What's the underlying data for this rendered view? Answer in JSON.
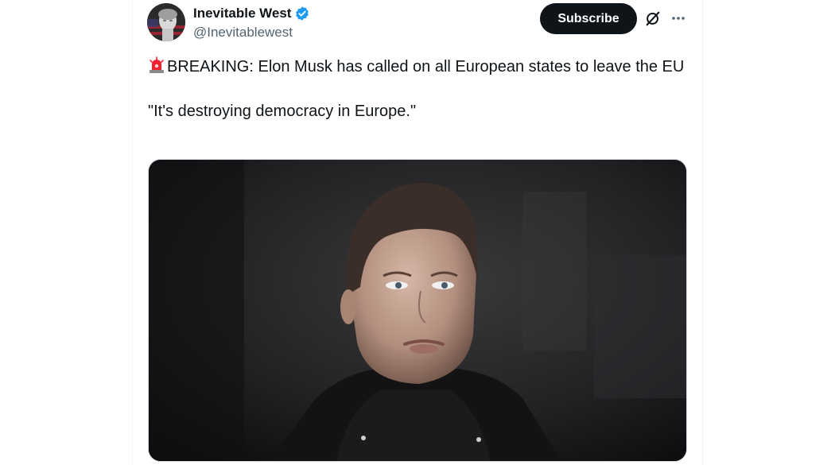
{
  "author": {
    "display_name": "Inevitable West",
    "handle": "@Inevitablewest",
    "verified": true,
    "verified_color": "#1d9bf0",
    "avatar_icon": "statue-flag-avatar"
  },
  "actions": {
    "subscribe_label": "Subscribe",
    "grok_icon": "grok-icon",
    "more_icon": "more-icon"
  },
  "tweet": {
    "emoji": "rotating-light-icon",
    "line1": "BREAKING: Elon Musk has called on all European states to leave the EU",
    "line2": "\"It's destroying democracy in Europe.\""
  },
  "media": {
    "type": "photo",
    "icon": "photo-of-man-in-black-hoodie"
  },
  "colors": {
    "text": "#0f1419",
    "secondary": "#536471",
    "button_bg": "#0f1419",
    "button_text": "#ffffff"
  }
}
